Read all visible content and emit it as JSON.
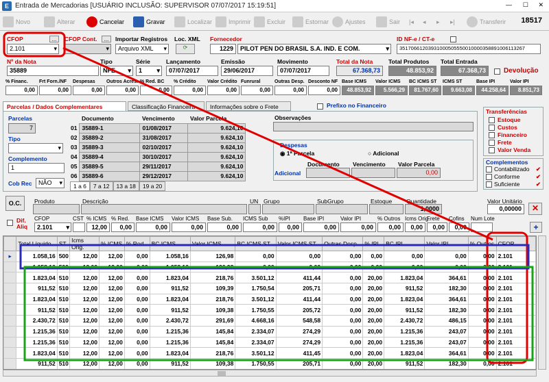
{
  "window": {
    "title": "Entrada de Mercadorias [USUÁRIO INCLUSÃO: SUPERVISOR 07/07/2017 15:19:51]",
    "minimize": "—",
    "maximize": "☐",
    "close": "✕"
  },
  "toolbar": {
    "novo": "Novo",
    "alterar": "Alterar",
    "cancelar": "Cancelar",
    "gravar": "Gravar",
    "localizar": "Localizar",
    "imprimir": "Imprimir",
    "excluir": "Excluir",
    "estornar": "Estornar",
    "ajustes": "Ajustes",
    "sair": "Sair",
    "transferir": "Transferir",
    "record": "18517"
  },
  "header": {
    "cfop_label": "CFOP",
    "cfop_value": "2.101",
    "cfop_cont_label": "CFOP Cont.",
    "import_label": "Importar Registros",
    "import_value": "Arquivo XML",
    "loc_xml_label": "Loc. XML",
    "fornecedor_label": "Fornecedor",
    "fornecedor_code": "1229",
    "fornecedor_name": "PILOT PEN DO BRASIL S.A. IND. E COM.",
    "idnfe_label": "ID NF-e / CT-e",
    "idnfe_value": "35170661203931000505550010000358891006113267",
    "nota_label": "Nº da Nota",
    "nota_value": "35889",
    "tipo_label": "Tipo",
    "tipo_value": "NFE",
    "serie_label": "Série",
    "serie_value": "1",
    "lanc_label": "Lançamento",
    "lanc_value": "07/07/2017",
    "emissao_label": "Emissão",
    "emissao_value": "29/06/2017",
    "mov_label": "Movimento",
    "mov_value": "07/07/2017",
    "total_nota_label": "Total da Nota",
    "total_nota_value": "67.368,73",
    "total_prod_label": "Total Produtos",
    "total_prod_value": "48.853,92",
    "total_entr_label": "Total Entrada",
    "total_entr_value": "67.368,73",
    "devolucao_label": "Devolução"
  },
  "totals_row": {
    "labels": [
      "% Financ.",
      "Frt Forn./NF",
      "Despesas",
      "Outros Acres.",
      "% Red. BC",
      "% Crédito",
      "Valor Crédito",
      "Funrural",
      "Outras Desp.",
      "Desconto NF",
      "Base ICMS",
      "Valor ICMS",
      "BC ICMS ST",
      "ICMS ST",
      "Base IPI",
      "Valor IPI"
    ],
    "values": [
      "0,00",
      "0,00",
      "0,00",
      "0,00",
      "0,00",
      "0,00",
      "0,00",
      "0,00",
      "0,00",
      "0,00",
      "48.853,92",
      "5.566,29",
      "81.767,60",
      "9.663,08",
      "44.258,64",
      "8.851,73"
    ]
  },
  "tabs": [
    "Parcelas / Dados Complementares",
    "Classificação Financeira",
    "Informações sobre o Frete"
  ],
  "prefixo_label": "Prefixo no Financeiro",
  "parcelas": {
    "label": "Parcelas",
    "count": "7",
    "tipo_label": "Tipo",
    "complemento_label": "Complemento",
    "complemento_value": "1",
    "cobrec_label": "Cob Rec",
    "cobrec_value": "NÃO",
    "headers": [
      "Documento",
      "Vencimento",
      "Valor Parcela"
    ],
    "rows": [
      [
        "01",
        "35889-1",
        "01/08/2017",
        "9.624,10"
      ],
      [
        "02",
        "35889-2",
        "31/08/2017",
        "9.624,10"
      ],
      [
        "03",
        "35889-3",
        "02/10/2017",
        "9.624,10"
      ],
      [
        "04",
        "35889-4",
        "30/10/2017",
        "9.624,10"
      ],
      [
        "05",
        "35889-5",
        "29/11/2017",
        "9.624,10"
      ],
      [
        "06",
        "35889-6",
        "29/12/2017",
        "9.624,10"
      ]
    ],
    "pages": [
      "1 a 6",
      "7 a 12",
      "13 a 18",
      "19 a 20"
    ]
  },
  "obs_label": "Observações",
  "despesas": {
    "label": "Despesas",
    "opt1": "1ª Parcela",
    "opt2": "Adicional",
    "doc": "Documento",
    "venc": "Vencimento",
    "valor": "Valor Parcela",
    "adicional_label": "Adicional",
    "valor_value": "0,00"
  },
  "transferencias": {
    "label": "Transferências",
    "items": [
      "Estoque",
      "Custos",
      "Financeiro",
      "Frete",
      "Valor Venda"
    ]
  },
  "complementos": {
    "label": "Complementos",
    "items": [
      "Contabilizado",
      "Conforme",
      "Suficiente"
    ]
  },
  "item_form": {
    "oc": "O.C.",
    "produto": "Produto",
    "descricao": "Descrição",
    "un": "UN",
    "grupo": "Grupo",
    "subgrupo": "SubGrupo",
    "estoque": "Estoque",
    "quantidade": "Quantidade",
    "quantidade_value": "1,0000",
    "valor_unit": "Valor Unitário",
    "valor_unit_value": "0,00000",
    "dif_aliq": "Dif. Aliq",
    "labels2": [
      "CFOP",
      "CST",
      "% ICMS",
      "% Red.",
      "Base ICMS",
      "Valor ICMS",
      "Base Sub.",
      "ICMS Sub",
      "%IPI",
      "Base IPI",
      "Valor IPI",
      "% Outros",
      "Icms Orig.",
      "Frete",
      "Cofins",
      "Num Lote"
    ],
    "values2": [
      "2.101",
      "",
      "12,00",
      "0,00",
      "0,00",
      "0,00",
      "0,00",
      "0,00",
      "0,00",
      "0,00",
      "0,00",
      "0,00",
      "0,00",
      "0,00",
      "0,00",
      ""
    ]
  },
  "grid": {
    "headers": [
      "",
      "Total Líquido",
      "ST",
      "Icms Orig.",
      "% ICMS",
      "% Red",
      "BC ICMS",
      "Valor ICMS",
      "BC ICMS ST",
      "Valor ICMS ST",
      "Outras Desp.",
      "% IPI",
      "BC IPI",
      "Valor IPI",
      "% Outros",
      "CFOP"
    ],
    "rows": [
      [
        "▸",
        "1.058,16",
        "500",
        "12,00",
        "12,00",
        "0,00",
        "1.058,16",
        "126,98",
        "0,00",
        "0,00",
        "0,00",
        "0,00",
        "0,00",
        "0,00",
        "0,00",
        "2.101"
      ],
      [
        "",
        "1.058,16",
        "500",
        "12,00",
        "12,00",
        "0,00",
        "1.058,16",
        "126,98",
        "0,00",
        "0,00",
        "0,00",
        "0,00",
        "0,00",
        "0,00",
        "0,00",
        "2.101"
      ],
      [
        "",
        "1.823,04",
        "510",
        "12,00",
        "12,00",
        "0,00",
        "1.823,04",
        "218,76",
        "3.501,12",
        "411,44",
        "0,00",
        "20,00",
        "1.823,04",
        "364,61",
        "0,00",
        "2.101"
      ],
      [
        "",
        "911,52",
        "510",
        "12,00",
        "12,00",
        "0,00",
        "911,52",
        "109,39",
        "1.750,54",
        "205,71",
        "0,00",
        "20,00",
        "911,52",
        "182,30",
        "0,00",
        "2.101"
      ],
      [
        "",
        "1.823,04",
        "510",
        "12,00",
        "12,00",
        "0,00",
        "1.823,04",
        "218,76",
        "3.501,12",
        "411,44",
        "0,00",
        "20,00",
        "1.823,04",
        "364,61",
        "0,00",
        "2.101"
      ],
      [
        "",
        "911,52",
        "510",
        "12,00",
        "12,00",
        "0,00",
        "911,52",
        "109,38",
        "1.750,55",
        "205,72",
        "0,00",
        "20,00",
        "911,52",
        "182,30",
        "0,00",
        "2.101"
      ],
      [
        "",
        "2.430,72",
        "510",
        "12,00",
        "12,00",
        "0,00",
        "2.430,72",
        "291,69",
        "4.668,16",
        "548,58",
        "0,00",
        "20,00",
        "2.430,72",
        "486,15",
        "0,00",
        "2.101"
      ],
      [
        "",
        "1.215,36",
        "510",
        "12,00",
        "12,00",
        "0,00",
        "1.215,36",
        "145,84",
        "2.334,07",
        "274,29",
        "0,00",
        "20,00",
        "1.215,36",
        "243,07",
        "0,00",
        "2.101"
      ],
      [
        "",
        "1.215,36",
        "510",
        "12,00",
        "12,00",
        "0,00",
        "1.215,36",
        "145,84",
        "2.334,07",
        "274,29",
        "0,00",
        "20,00",
        "1.215,36",
        "243,07",
        "0,00",
        "2.101"
      ],
      [
        "",
        "1.823,04",
        "510",
        "12,00",
        "12,00",
        "0,00",
        "1.823,04",
        "218,76",
        "3.501,12",
        "411,45",
        "0,00",
        "20,00",
        "1.823,04",
        "364,61",
        "0,00",
        "2.101"
      ],
      [
        "",
        "911,52",
        "510",
        "12,00",
        "12,00",
        "0,00",
        "911,52",
        "109,38",
        "1.750,55",
        "205,71",
        "0,00",
        "20,00",
        "911,52",
        "182,30",
        "0,00",
        "2.101"
      ]
    ]
  },
  "colors": {
    "annotation_red": "#e00000",
    "annotation_blue": "#2a2ab8",
    "annotation_green": "#1aa31a",
    "accent_red": "#c00000",
    "nota_blue": "#0033aa"
  }
}
